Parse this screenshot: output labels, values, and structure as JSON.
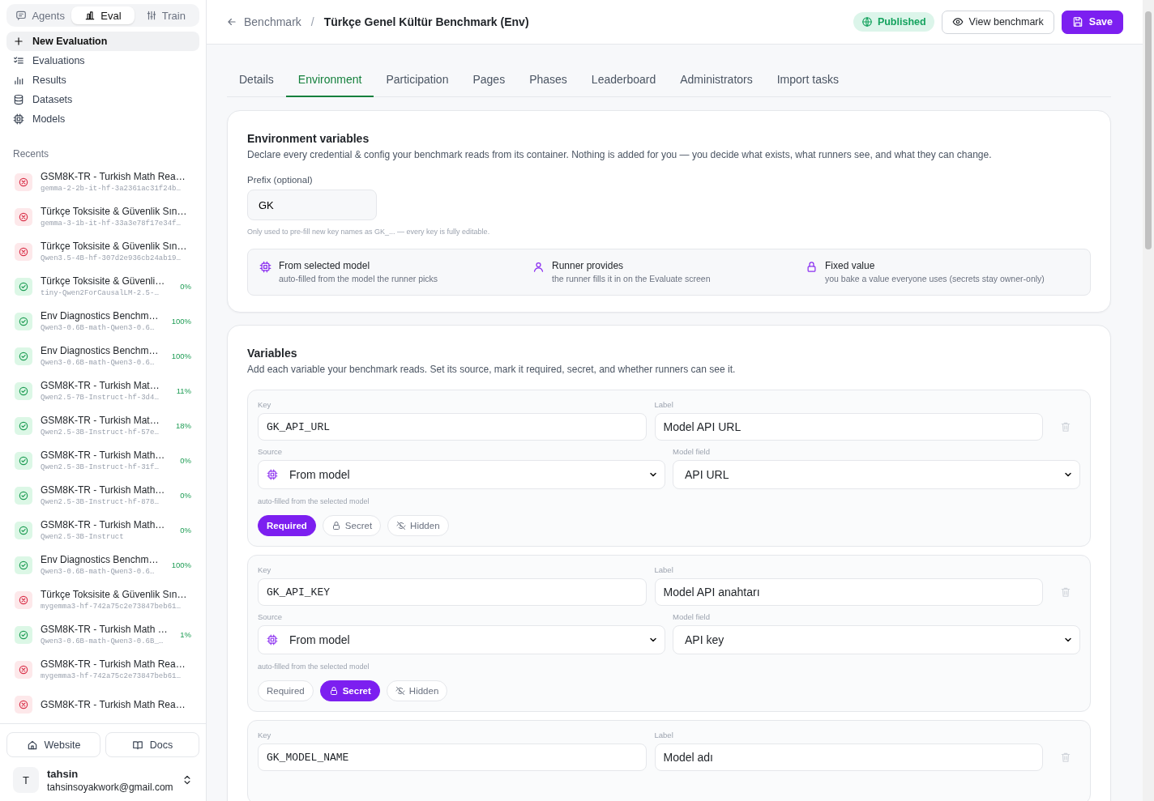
{
  "sidebar": {
    "mode_tabs": [
      {
        "kind": "agents",
        "label": "Agents",
        "selected": false
      },
      {
        "kind": "eval",
        "label": "Eval",
        "selected": true
      },
      {
        "kind": "train",
        "label": "Train",
        "selected": false
      }
    ],
    "nav": [
      {
        "kind": "new",
        "label": "New Evaluation",
        "selected": true
      },
      {
        "kind": "list",
        "label": "Evaluations",
        "selected": false
      },
      {
        "kind": "results",
        "label": "Results",
        "selected": false
      },
      {
        "kind": "datasets",
        "label": "Datasets",
        "selected": false
      },
      {
        "kind": "models",
        "label": "Models",
        "selected": false
      }
    ],
    "recents_title": "Recents",
    "recents": [
      {
        "kind": "failed",
        "title": "GSM8K-TR - Turkish Math Rea…",
        "model": "gemma-2-2b-it-hf-3a2361ac31f24b…"
      },
      {
        "kind": "failed",
        "title": "Türkçe Toksisite & Güvenlik Sın…",
        "model": "gemma-3-1b-it-hf-33a3e78f17e34f…"
      },
      {
        "kind": "failed",
        "title": "Türkçe Toksisite & Güvenlik Sın…",
        "model": "Qwen3.5-4B-hf-307d2e936cb24ab19…"
      },
      {
        "kind": "done",
        "title": "Türkçe Toksisite & Güvenli…",
        "model": "tiny-Qwen2ForCausalLM-2.5-…",
        "score": "0%"
      },
      {
        "kind": "done",
        "title": "Env Diagnostics Benchm…",
        "model": "Qwen3-0.6B-math-Qwen3-0.6…",
        "score": "100%"
      },
      {
        "kind": "done",
        "title": "Env Diagnostics Benchm…",
        "model": "Qwen3-0.6B-math-Qwen3-0.6…",
        "score": "100%"
      },
      {
        "kind": "done",
        "title": "GSM8K-TR - Turkish Mat…",
        "model": "Qwen2.5-7B-Instruct-hf-3d4…",
        "score": "11%"
      },
      {
        "kind": "done",
        "title": "GSM8K-TR - Turkish Mat…",
        "model": "Qwen2.5-3B-Instruct-hf-57e…",
        "score": "18%"
      },
      {
        "kind": "done",
        "title": "GSM8K-TR - Turkish Math…",
        "model": "Qwen2.5-3B-Instruct-hf-31f…",
        "score": "0%"
      },
      {
        "kind": "done",
        "title": "GSM8K-TR - Turkish Math…",
        "model": "Qwen2.5-3B-Instruct-hf-878…",
        "score": "0%"
      },
      {
        "kind": "done",
        "title": "GSM8K-TR - Turkish Math…",
        "model": "Qwen2.5-3B-Instruct",
        "score": "0%"
      },
      {
        "kind": "done",
        "title": "Env Diagnostics Benchm…",
        "model": "Qwen3-0.6B-math-Qwen3-0.6…",
        "score": "100%"
      },
      {
        "kind": "failed",
        "title": "Türkçe Toksisite & Güvenlik Sın…",
        "model": "mygemma3-hf-742a75c2e73847beb61…"
      },
      {
        "kind": "done",
        "title": "GSM8K-TR - Turkish Math …",
        "model": "Qwen3-0.6B-math-Qwen3-0.6B_…",
        "score": "1%"
      },
      {
        "kind": "failed",
        "title": "GSM8K-TR - Turkish Math Rea…",
        "model": "mygemma3-hf-742a75c2e73847beb61…"
      },
      {
        "kind": "failed",
        "title": "GSM8K-TR - Turkish Math Rea…"
      }
    ],
    "footer_links": [
      {
        "kind": "website",
        "label": "Website"
      },
      {
        "kind": "docs",
        "label": "Docs"
      }
    ],
    "user": {
      "initial": "T",
      "name": "tahsin",
      "email": "tahsinsoyakwork@gmail.com"
    }
  },
  "header": {
    "back_label": "Benchmark",
    "separator": "/",
    "title": "Türkçe Genel Kültür Benchmark (Env)",
    "status_badge": "Published",
    "actions": [
      {
        "kind": "view",
        "label": "View benchmark"
      },
      {
        "kind": "save",
        "label": "Save"
      }
    ]
  },
  "tabs": [
    {
      "label": "Details",
      "selected": false
    },
    {
      "label": "Environment",
      "selected": true
    },
    {
      "label": "Participation",
      "selected": false
    },
    {
      "label": "Pages",
      "selected": false
    },
    {
      "label": "Phases",
      "selected": false
    },
    {
      "label": "Leaderboard",
      "selected": false
    },
    {
      "label": "Administrators",
      "selected": false
    },
    {
      "label": "Import tasks",
      "selected": false
    }
  ],
  "environment": {
    "title": "Environment variables",
    "description": "Declare every credential & config your benchmark reads from its container. Nothing is added for you — you decide what exists, what runners see, and what they can change.",
    "prefix_label": "Prefix (optional)",
    "prefix_value": "GK",
    "prefix_hint": "Only used to pre-fill new key names as GK_... — every key is fully editable.",
    "sources": [
      {
        "kind": "model",
        "title": "From selected model",
        "description": "auto-filled from the model the runner picks"
      },
      {
        "kind": "runner",
        "title": "Runner provides",
        "description": "the runner fills it in on the Evaluate screen"
      },
      {
        "kind": "fixed",
        "title": "Fixed value",
        "description": "you bake a value everyone uses (secrets stay owner-only)"
      }
    ]
  },
  "variables": {
    "title": "Variables",
    "description": "Add each variable your benchmark reads. Set its source, mark it required, secret, and whether runners can see it.",
    "items": [
      {
        "key_label": "Key",
        "key": "GK_API_URL",
        "label_label": "Label",
        "label": "Model API URL",
        "source_label": "Source",
        "source": {
          "kind": "model",
          "value": "From model"
        },
        "model_field_label": "Model field",
        "model_field": "API URL",
        "source_hint": "auto-filled from the selected model",
        "flags": [
          {
            "kind": "required",
            "label": "Required",
            "selected": true
          },
          {
            "kind": "secret",
            "label": "Secret",
            "selected": false
          },
          {
            "kind": "hidden",
            "label": "Hidden",
            "selected": false
          }
        ]
      },
      {
        "key_label": "Key",
        "key": "GK_API_KEY",
        "label_label": "Label",
        "label": "Model API anahtarı",
        "source_label": "Source",
        "source": {
          "kind": "model",
          "value": "From model"
        },
        "model_field_label": "Model field",
        "model_field": "API key",
        "source_hint": "auto-filled from the selected model",
        "flags": [
          {
            "kind": "required",
            "label": "Required",
            "selected": false
          },
          {
            "kind": "secret",
            "label": "Secret",
            "selected": true
          },
          {
            "kind": "hidden",
            "label": "Hidden",
            "selected": false
          }
        ]
      },
      {
        "key_label": "Key",
        "key": "GK_MODEL_NAME",
        "label_label": "Label",
        "label": "Model adı"
      }
    ]
  }
}
